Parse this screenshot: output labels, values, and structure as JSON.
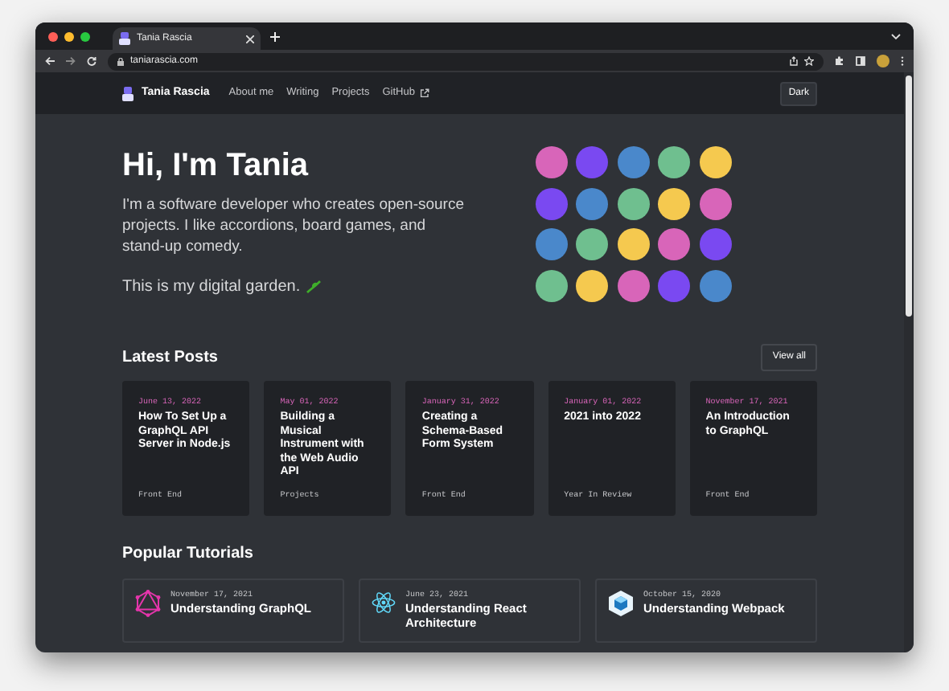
{
  "browser": {
    "tab_title": "Tania Rascia",
    "url": "taniarascia.com"
  },
  "nav": {
    "brand": "Tania Rascia",
    "links": [
      {
        "label": "About me",
        "external": false
      },
      {
        "label": "Writing",
        "external": false
      },
      {
        "label": "Projects",
        "external": false
      },
      {
        "label": "GitHub",
        "external": true
      }
    ],
    "theme_button": "Dark"
  },
  "hero": {
    "title": "Hi, I'm Tania",
    "intro": "I'm a software developer who creates open-source projects. I like accordions, board games, and stand-up comedy.",
    "garden": "This is my digital garden.",
    "dots": [
      {
        "color": "#d865b9"
      },
      {
        "color": "#7a49f1"
      },
      {
        "color": "#4a88cb"
      },
      {
        "color": "#6fbf8f"
      },
      {
        "color": "#f5c94f"
      },
      {
        "color": "#7a49f1"
      },
      {
        "color": "#4a88cb"
      },
      {
        "color": "#6fbf8f"
      },
      {
        "color": "#f5c94f"
      },
      {
        "color": "#d865b9"
      },
      {
        "color": "#4a88cb"
      },
      {
        "color": "#6fbf8f"
      },
      {
        "color": "#f5c94f"
      },
      {
        "color": "#d865b9"
      },
      {
        "color": "#7a49f1"
      },
      {
        "color": "#6fbf8f"
      },
      {
        "color": "#f5c94f"
      },
      {
        "color": "#d865b9"
      },
      {
        "color": "#7a49f1"
      },
      {
        "color": "#4a88cb"
      }
    ]
  },
  "latest_posts": {
    "heading": "Latest Posts",
    "view_all": "View all",
    "posts": [
      {
        "date": "June 13, 2022",
        "title": "How To Set Up a GraphQL API Server in Node.js",
        "category": "Front End"
      },
      {
        "date": "May 01, 2022",
        "title": "Building a Musical Instrument with the Web Audio API",
        "category": "Projects"
      },
      {
        "date": "January 31, 2022",
        "title": "Creating a Schema-Based Form System",
        "category": "Front End"
      },
      {
        "date": "January 01, 2022",
        "title": "2021 into 2022",
        "category": "Year In Review"
      },
      {
        "date": "November 17, 2021",
        "title": "An Introduction to GraphQL",
        "category": "Front End"
      }
    ]
  },
  "popular_tutorials": {
    "heading": "Popular Tutorials",
    "tutorials": [
      {
        "kind": "graphql",
        "date": "November 17, 2021",
        "title": "Understanding GraphQL"
      },
      {
        "kind": "react",
        "date": "June 23, 2021",
        "title": "Understanding React Architecture"
      },
      {
        "kind": "webpack",
        "date": "October 15, 2020",
        "title": "Understanding Webpack"
      }
    ]
  }
}
